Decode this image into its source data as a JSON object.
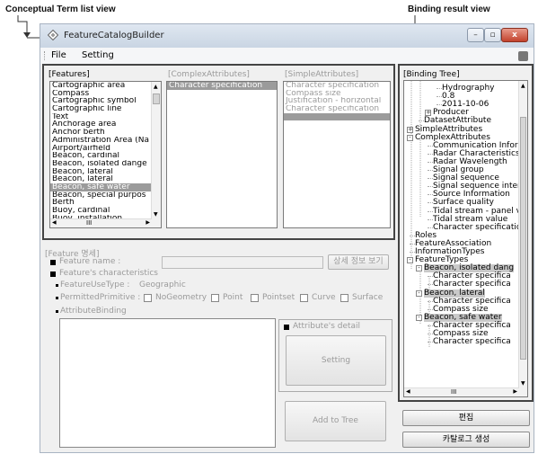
{
  "annotations": {
    "term_list": "Conceptual Term list view",
    "binding_result": "Binding result view"
  },
  "window": {
    "title": "FeatureCatalogBuilder",
    "controls": {
      "minimize": "–",
      "maximize": "▫",
      "close": "x"
    }
  },
  "menu": {
    "file": "File",
    "setting": "Setting"
  },
  "features_panel": {
    "label": "[Features]",
    "items": [
      "Cartographic area",
      "Compass",
      "Cartographic symbol",
      "Cartographic line",
      "Text",
      "Anchorage area",
      "Anchor berth",
      "Administration Area (Na",
      "Airport/airfield",
      "Beacon, cardinal",
      "Beacon, isolated dange",
      "Beacon, lateral",
      "Beacon, lateral",
      "Beacon, safe water",
      "Beacon, special purpos",
      "Berth",
      "Buoy, cardinal",
      "Buoy, installation"
    ],
    "selected_index": 13,
    "hscroll_text": "III"
  },
  "complex_panel": {
    "label": "[ComplexAttributes]",
    "items": [
      "Character specification"
    ],
    "selected_index": 0
  },
  "simple_panel": {
    "label": "[SimpleAttributes]",
    "items": [
      "Character specification",
      "Compass size",
      "Justification - horizontal",
      "Character specification",
      ""
    ],
    "selected_index": 4
  },
  "feature_form": {
    "header": "[Feature 명세]",
    "feature_name_label": "Feature name :",
    "feature_name_value": "",
    "detail_button": "상세 정보 보기",
    "characteristics_label": "Feature's characteristics",
    "use_type_label": "FeatureUseType :",
    "use_type_value": "Geographic",
    "primitive_label": "PermittedPrimitive :",
    "primitives": [
      "NoGeometry",
      "Point",
      "Pointset",
      "Curve",
      "Surface"
    ],
    "attribute_binding_label": "AttributeBinding",
    "attribute_detail_label": "Attribute's detail",
    "setting_button": "Setting",
    "add_button": "Add to Tree"
  },
  "binding_tree": {
    "label": "[Binding Tree]",
    "nodes": [
      {
        "text": "Hydrography",
        "level": 3,
        "expander": ""
      },
      {
        "text": "0.8",
        "level": 3,
        "expander": ""
      },
      {
        "text": "2011-10-06",
        "level": 3,
        "expander": ""
      },
      {
        "text": "Producer",
        "level": 2,
        "expander": "+"
      },
      {
        "text": "DatasetAttribute",
        "level": 1,
        "expander": ""
      },
      {
        "text": "SimpleAttributes",
        "level": 0,
        "expander": "+"
      },
      {
        "text": "ComplexAttributes",
        "level": 0,
        "expander": "-"
      },
      {
        "text": "Communication Inform",
        "level": 2,
        "expander": ""
      },
      {
        "text": "Radar Characteristics",
        "level": 2,
        "expander": ""
      },
      {
        "text": "Radar Wavelength",
        "level": 2,
        "expander": ""
      },
      {
        "text": "Signal group",
        "level": 2,
        "expander": ""
      },
      {
        "text": "Signal sequence",
        "level": 2,
        "expander": ""
      },
      {
        "text": "Signal sequence interv",
        "level": 2,
        "expander": ""
      },
      {
        "text": "Source Information",
        "level": 2,
        "expander": ""
      },
      {
        "text": "Surface quality",
        "level": 2,
        "expander": ""
      },
      {
        "text": "Tidal stream - panel v",
        "level": 2,
        "expander": ""
      },
      {
        "text": "Tidal stream value",
        "level": 2,
        "expander": ""
      },
      {
        "text": "Character specification",
        "level": 2,
        "expander": ""
      },
      {
        "text": "Roles",
        "level": 0,
        "expander": ""
      },
      {
        "text": "FeatureAssociation",
        "level": 0,
        "expander": ""
      },
      {
        "text": "InformationTypes",
        "level": 0,
        "expander": ""
      },
      {
        "text": "FeatureTypes",
        "level": 0,
        "expander": "-"
      },
      {
        "text": "Beacon, isolated dang",
        "level": 1,
        "expander": "-",
        "highlight": true
      },
      {
        "text": "Character specifica",
        "level": 2,
        "expander": ""
      },
      {
        "text": "Character specifica",
        "level": 2,
        "expander": ""
      },
      {
        "text": "Beacon, lateral",
        "level": 1,
        "expander": "-",
        "highlight": true
      },
      {
        "text": "Character specifica",
        "level": 2,
        "expander": ""
      },
      {
        "text": "Compass size",
        "level": 2,
        "expander": ""
      },
      {
        "text": "Beacon, safe water",
        "level": 1,
        "expander": "-",
        "highlight": true
      },
      {
        "text": "Character specifica",
        "level": 2,
        "expander": ""
      },
      {
        "text": "Compass size",
        "level": 2,
        "expander": ""
      },
      {
        "text": "Character specifica",
        "level": 2,
        "expander": ""
      }
    ],
    "hscroll_text": "III"
  },
  "buttons": {
    "edit": "편집",
    "generate_catalog": "카탈로그 생성"
  }
}
